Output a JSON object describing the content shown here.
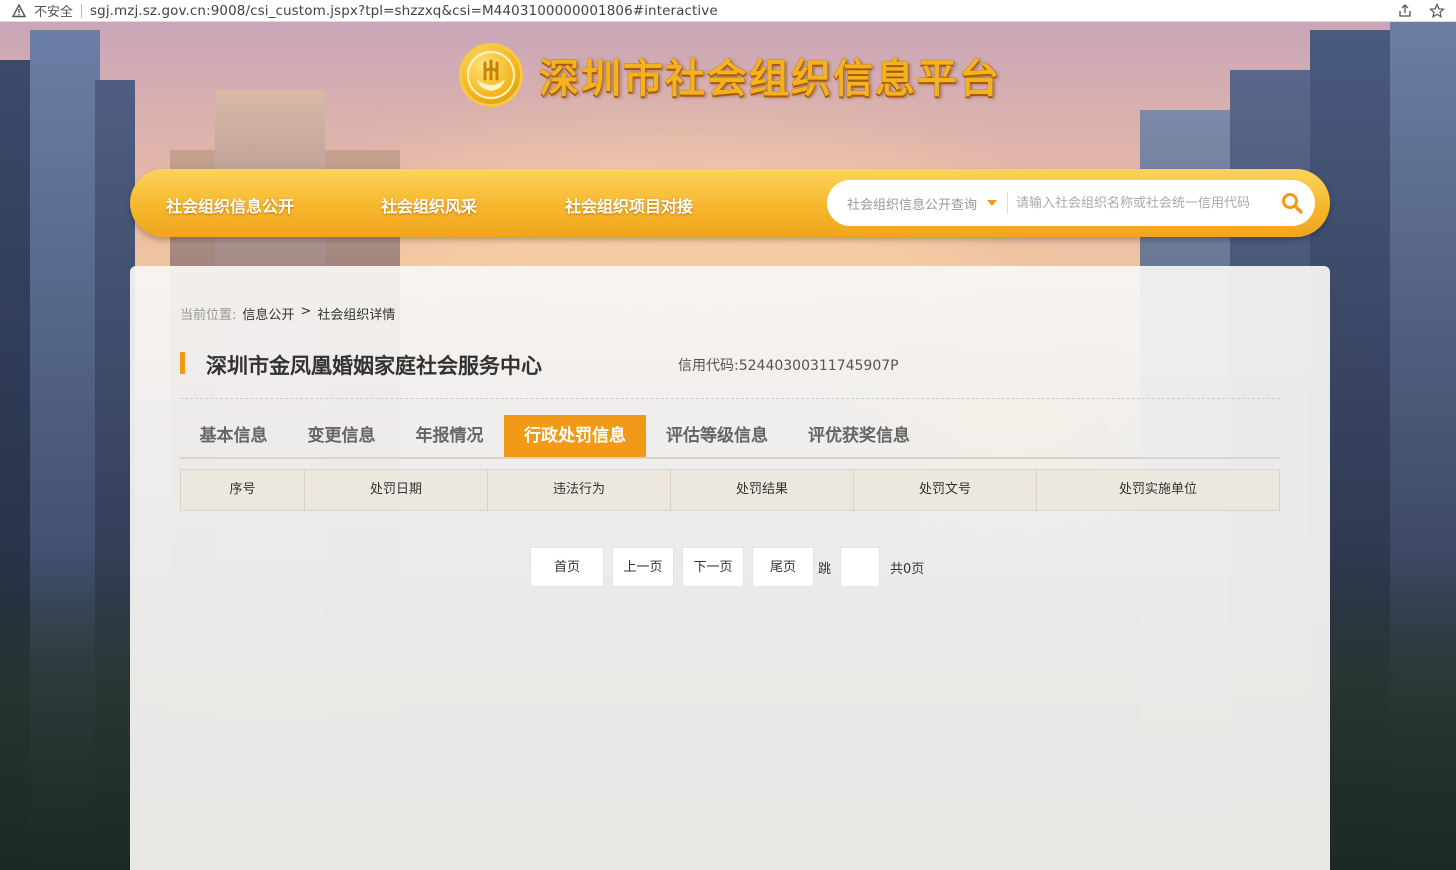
{
  "browser": {
    "insecure_label": "不安全",
    "url": "sgj.mzj.sz.gov.cn:9008/csi_custom.jspx?tpl=shzzxq&csi=M4403100000001806#interactive"
  },
  "site": {
    "title": "深圳市社会组织信息平台"
  },
  "nav": {
    "items": [
      "社会组织信息公开",
      "社会组织风采",
      "社会组织项目对接"
    ],
    "search_type": "社会组织信息公开查询",
    "search_placeholder": "请输入社会组织名称或社会统一信用代码"
  },
  "breadcrumb": {
    "prefix": "当前位置:",
    "items": [
      "信息公开",
      "社会组织详情"
    ],
    "separator": ">"
  },
  "org": {
    "name": "深圳市金凤凰婚姻家庭社会服务中心",
    "credit_label": "信用代码:",
    "credit_code": "52440300311745907P"
  },
  "tabs": {
    "items": [
      "基本信息",
      "变更信息",
      "年报情况",
      "行政处罚信息",
      "评估等级信息",
      "评优获奖信息"
    ],
    "active": "行政处罚信息"
  },
  "table": {
    "columns": [
      "序号",
      "处罚日期",
      "违法行为",
      "处罚结果",
      "处罚文号",
      "处罚实施单位"
    ],
    "rows": []
  },
  "pager": {
    "first": "首页",
    "prev": "上一页",
    "next": "下一页",
    "last": "尾页",
    "jump_label": "跳",
    "jump_value": "",
    "total": "共0页"
  },
  "colors": {
    "accent": "#f29a17",
    "nav_gold": "#f6b72d",
    "title_gold": "#f6b21e"
  }
}
